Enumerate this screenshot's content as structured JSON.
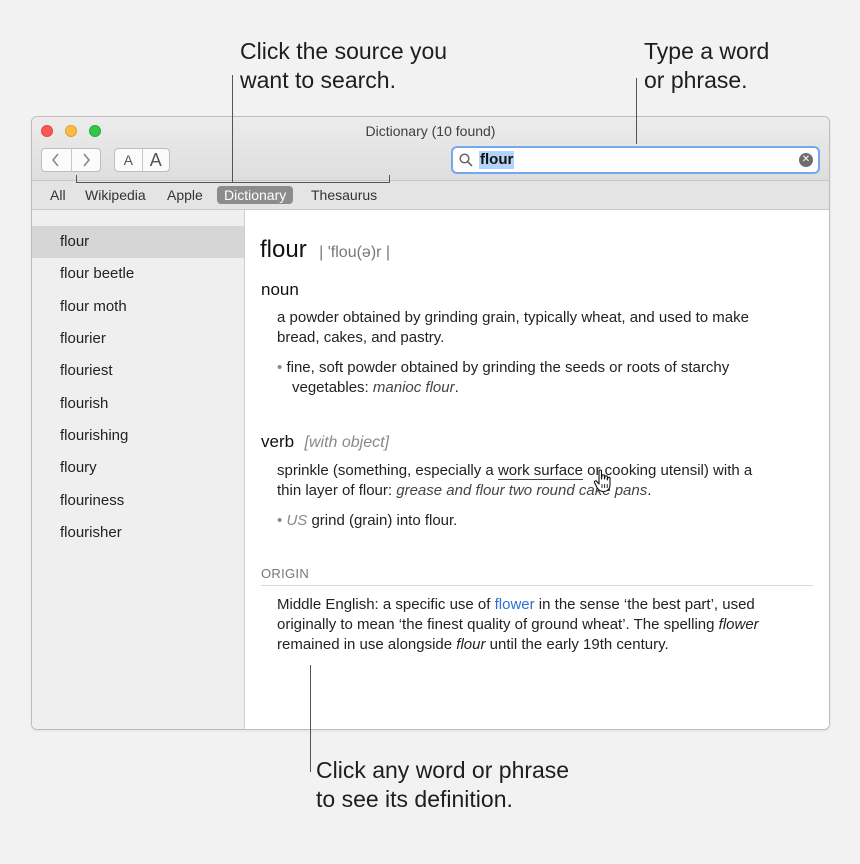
{
  "callouts": {
    "source": [
      "Click the source you",
      "want to search."
    ],
    "search": [
      "Type a word",
      "or phrase."
    ],
    "word": [
      "Click any word or phrase",
      "to see its definition."
    ]
  },
  "window": {
    "title": "Dictionary (10 found)",
    "font_small": "A",
    "font_large": "A"
  },
  "search": {
    "value": "flour"
  },
  "tabs": [
    "All",
    "Wikipedia",
    "Apple",
    "Dictionary",
    "Thesaurus"
  ],
  "active_tab": "Dictionary",
  "sidebar": {
    "items": [
      "flour",
      "flour beetle",
      "flour moth",
      "flourier",
      "flouriest",
      "flourish",
      "flourishing",
      "floury",
      "flouriness",
      "flourisher"
    ],
    "selected": "flour"
  },
  "entry": {
    "headword": "flour",
    "pronunciation": "| 'flou(ə)r |",
    "noun": {
      "label": "noun",
      "def1_line1": "a powder obtained by grinding grain, typically wheat, and used to make",
      "def1_line2": "bread, cakes, and pastry.",
      "bullet": "•",
      "sub_line1": "fine, soft powder obtained by grinding the seeds or roots of starchy",
      "sub_line2_text": "vegetables: ",
      "sub_line2_example": "manioc flour",
      "sub_line2_end": "."
    },
    "verb": {
      "label": "verb",
      "grammar": "[with object]",
      "def1_line1_a": "sprinkle (something, especially a ",
      "def1_line1_link": "work surface",
      "def1_line1_b": " or cooking utensil) with a",
      "def1_line2_text": "thin layer of flour: ",
      "def1_line2_example": "grease and flour two round cake pans",
      "def1_line2_end": ".",
      "bullet": "•",
      "region": "US",
      "sub_text": " grind (grain) into flour."
    },
    "origin": {
      "label": "ORIGIN",
      "line1_a": "Middle English: a specific use of ",
      "line1_link": "flower",
      "line1_b": " in the sense ‘the best part’, used",
      "line2_a": "originally to mean ‘the finest quality of ground wheat’. The spelling ",
      "line2_italic": "flower",
      "line3_a": "remained in use alongside ",
      "line3_italic": "flour",
      "line3_b": " until the early 19th century."
    }
  },
  "colors": {
    "accent_link": "#2f6fd6",
    "search_focus": "#74a7f0",
    "tab_active": "#8c8c8c"
  }
}
